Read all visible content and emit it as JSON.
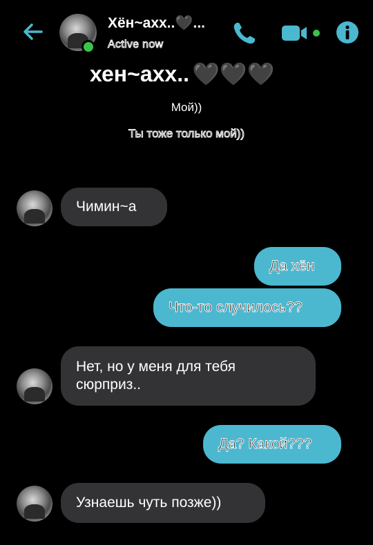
{
  "header": {
    "contact_name": "Хён~ахх..🖤...",
    "status": "Active now",
    "icons": {
      "back": "back-arrow-icon",
      "call": "phone-icon",
      "video": "video-camera-icon",
      "info": "info-icon"
    },
    "accent_color": "#4bb8d0",
    "online_color": "#3ac34a"
  },
  "conversation": {
    "title": "хен~ахх..",
    "title_hearts": "🖤🖤🖤",
    "subtitle_1": "Мой))",
    "subtitle_2": "Ты тоже только мой))"
  },
  "messages": [
    {
      "direction": "incoming",
      "text": "Чимин~а"
    },
    {
      "direction": "outgoing",
      "text": "Да хён"
    },
    {
      "direction": "outgoing",
      "text": "Что-то случилось??"
    },
    {
      "direction": "incoming",
      "text": "Нет, но у меня для тебя сюрприз.."
    },
    {
      "direction": "outgoing",
      "text": "Да? Какой???"
    },
    {
      "direction": "incoming",
      "text": "Узнаешь чуть позже))"
    }
  ]
}
